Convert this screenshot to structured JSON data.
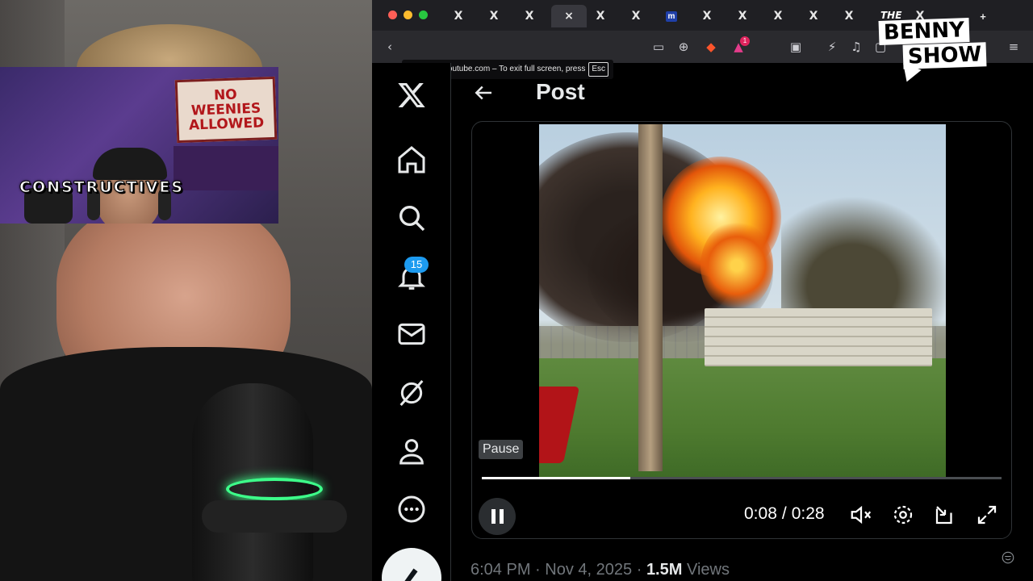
{
  "stream_overlay": {
    "inset_label": "CONSTRUCTIVES",
    "poster_text": "NO WEENIES ALLOWED",
    "logo_small": "THE",
    "logo_line1": "BENNY",
    "logo_line2": "SHOW"
  },
  "browser": {
    "fullscreen_notice": "www.youtube.com – To exit full screen, press",
    "fullscreen_key": "Esc",
    "tabs": [
      "X",
      "X",
      "X",
      "×",
      "X",
      "X",
      "m",
      "X",
      "X",
      "X",
      "X",
      "X",
      "X",
      "X"
    ],
    "new_tab": "+",
    "brave_badge": "1"
  },
  "x_app": {
    "notifications_count": "15",
    "post_header": "Post",
    "nav": [
      "x-logo",
      "home-icon",
      "search-icon",
      "bell-icon",
      "mail-icon",
      "grok-icon",
      "profile-icon",
      "more-icon"
    ],
    "video": {
      "tooltip": "Pause",
      "current_time": "0:08",
      "separator": "/",
      "duration": "0:28",
      "progress_fraction": 0.286
    },
    "meta": {
      "time": "6:04 PM",
      "sep1": "·",
      "date": "Nov 4, 2025",
      "sep2": "·",
      "views_count": "1.5M",
      "views_label": "Views"
    }
  },
  "colors": {
    "accent": "#1d9bf0",
    "mic_glow": "#3dff8a"
  }
}
